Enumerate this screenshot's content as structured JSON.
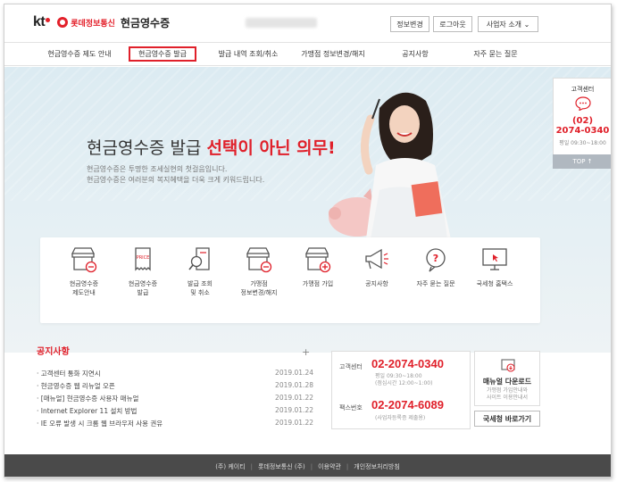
{
  "header": {
    "brand_kt": "kt",
    "brand_sub": "롯데정보통신",
    "title": "현금영수증",
    "buttons": {
      "info": "정보변경",
      "logout": "로그아웃",
      "business": "사업자 소개 ⌄"
    }
  },
  "nav": {
    "items": [
      "현금영수증 제도 안내",
      "현금영수증 발급",
      "발급 내역 조회/취소",
      "가맹점 정보변경/해지",
      "공지사항",
      "자주 묻는 질문"
    ]
  },
  "hero": {
    "heading_plain": "현금영수증 발급 ",
    "heading_red": "선택이 아닌 의무!",
    "line1": "현금영수증은 투명한 조세실현의 첫걸음입니다.",
    "line2": "현금영수증은 여러분의 복지혜택을 더욱 크게 키워드립니다."
  },
  "side": {
    "title": "고객센터",
    "phone1": "(02)",
    "phone2": "2074-0340",
    "hours": "평일 09:30~18:00",
    "top": "TOP ↑"
  },
  "quick": [
    {
      "l1": "현금영수증",
      "l2": "제도안내",
      "icon": "store-minus-icon"
    },
    {
      "l1": "현금영수증",
      "l2": "발급",
      "icon": "price-receipt-icon"
    },
    {
      "l1": "발급 조회",
      "l2": "및 취소",
      "icon": "search-receipt-icon"
    },
    {
      "l1": "가맹점",
      "l2": "정보변경/해지",
      "icon": "store-minus-icon"
    },
    {
      "l1": "가맹점 가입",
      "l2": "",
      "icon": "store-plus-icon"
    },
    {
      "l1": "공지사항",
      "l2": "",
      "icon": "megaphone-icon"
    },
    {
      "l1": "자주 묻는 질문",
      "l2": "",
      "icon": "question-icon"
    },
    {
      "l1": "국세청 홈택스",
      "l2": "",
      "icon": "monitor-icon"
    }
  ],
  "notice": {
    "title": "공지사항",
    "plus": "+",
    "items": [
      {
        "text": "· 고객센터 통화 지연시",
        "date": "2019.01.24"
      },
      {
        "text": "· 현금영수증 웹 리뉴얼 오픈",
        "date": "2019.01.28"
      },
      {
        "text": "· [매뉴얼] 현금영수증 사용자 매뉴얼",
        "date": "2019.01.22"
      },
      {
        "text": "· Internet Explorer 11 설치 방법",
        "date": "2019.01.22"
      },
      {
        "text": "· IE 오류 발생 시 크롬 웹 브라우저 사용 권유",
        "date": "2019.01.22"
      }
    ]
  },
  "contact": {
    "center_label": "고객센터",
    "center_num": "02-2074-0340",
    "center_hours1": "평일 09:30~18:00",
    "center_hours2": "(점심시간 12:00~1:00)",
    "fax_label": "팩스번호",
    "fax_num": "02-2074-6089",
    "fax_note": "(사업자등록증 제출용)"
  },
  "manual": {
    "title": "매뉴얼 다운로드",
    "sub1": "가맹점 가입안내와",
    "sub2": "사이트 이용안내서",
    "nts_button": "국세청 바로가기"
  },
  "footer": {
    "items": [
      "(주) 케이티",
      "롯데정보통신 (주)",
      "이용약관",
      "개인정보처리방침"
    ]
  },
  "colors": {
    "accent": "#e0202a",
    "footer": "#4a4a4a"
  }
}
